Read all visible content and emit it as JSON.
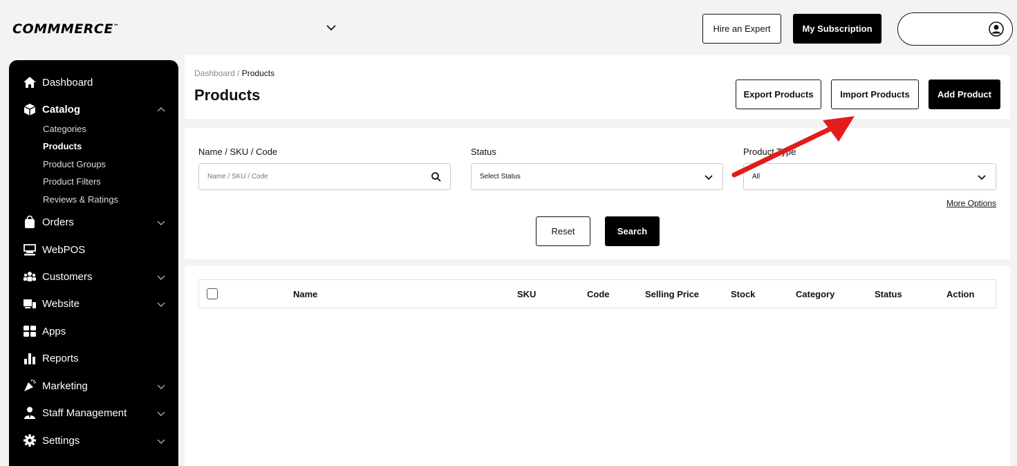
{
  "app": {
    "logo": "COMMMERCE",
    "logo_mark": "™"
  },
  "topbar": {
    "hire_label": "Hire an Expert",
    "subscription_label": "My Subscription"
  },
  "sidebar": {
    "items": [
      {
        "label": "Dashboard",
        "icon": "home-icon"
      },
      {
        "label": "Catalog",
        "icon": "box-icon"
      },
      {
        "label": "Orders",
        "icon": "shopping-bag-icon"
      },
      {
        "label": "WebPOS",
        "icon": "pos-icon"
      },
      {
        "label": "Customers",
        "icon": "users-icon"
      },
      {
        "label": "Website",
        "icon": "website-icon"
      },
      {
        "label": "Apps",
        "icon": "apps-icon"
      },
      {
        "label": "Reports",
        "icon": "bar-chart-icon"
      },
      {
        "label": "Marketing",
        "icon": "megaphone-icon"
      },
      {
        "label": "Staff Management",
        "icon": "staff-icon"
      },
      {
        "label": "Settings",
        "icon": "gear-icon"
      }
    ],
    "catalog_sub": [
      "Categories",
      "Products",
      "Product Groups",
      "Product Filters",
      "Reviews & Ratings"
    ]
  },
  "header": {
    "breadcrumb_root": "Dashboard",
    "breadcrumb_sep": " / ",
    "breadcrumb_current": "Products",
    "title": "Products",
    "export_label": "Export Products",
    "import_label": "Import Products",
    "add_label": "Add Product"
  },
  "filters": {
    "name_label": "Name / SKU / Code",
    "name_placeholder": "Name / SKU / Code",
    "status_label": "Status",
    "status_value": "Select Status",
    "type_label": "Product Type",
    "type_value": "All",
    "more_options": "More Options",
    "reset_label": "Reset",
    "search_label": "Search"
  },
  "table": {
    "columns": [
      "Name",
      "SKU",
      "Code",
      "Selling Price",
      "Stock",
      "Category",
      "Status",
      "Action"
    ]
  },
  "colors": {
    "accent_arrow": "#e31b1b",
    "sidebar_bg": "#000000"
  }
}
